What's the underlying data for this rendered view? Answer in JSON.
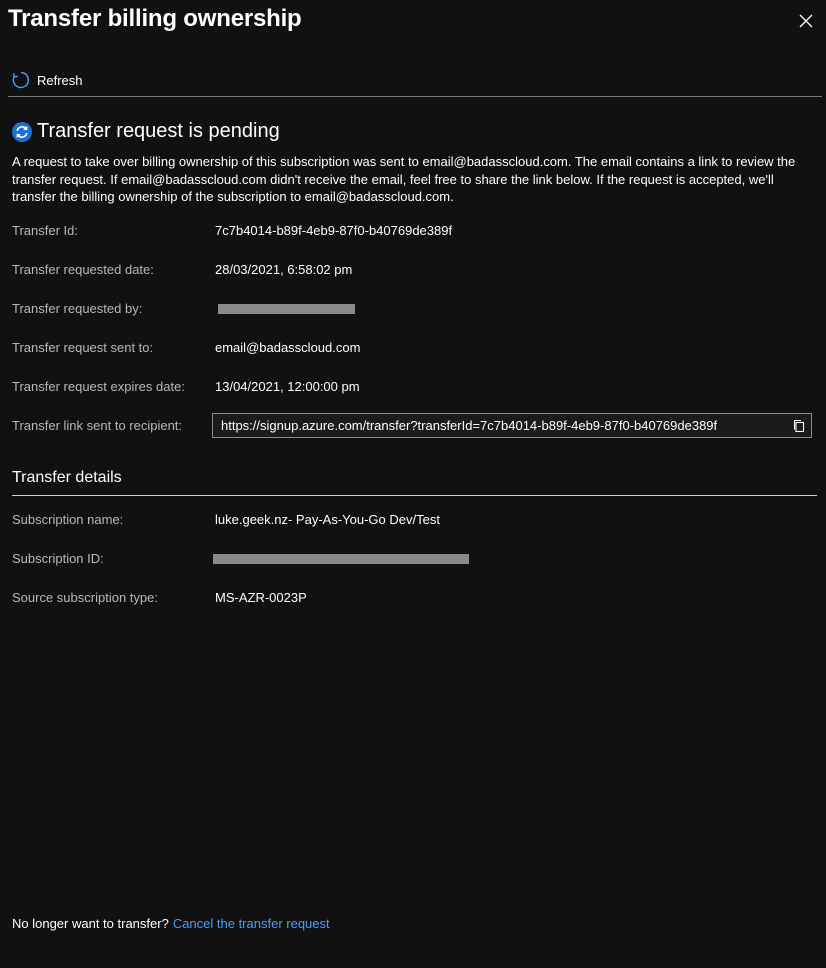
{
  "panel": {
    "title": "Transfer billing ownership",
    "close_icon": "close-icon"
  },
  "toolbar": {
    "refresh_label": "Refresh",
    "refresh_icon": "refresh-icon"
  },
  "status": {
    "heading": "Transfer request is pending",
    "icon": "sync-status-icon",
    "description": "A request to take over billing ownership of this subscription was sent to email@badasscloud.com. The email contains a link to review the transfer request. If email@badasscloud.com didn't receive the email, feel free to share the link below. If the request is accepted, we'll transfer the billing ownership of the subscription to email@badasscloud.com."
  },
  "transfer": {
    "id_label": "Transfer Id:",
    "id_value": "7c7b4014-b89f-4eb9-87f0-b40769de389f",
    "date_label": "Transfer requested date:",
    "date_value": "28/03/2021, 6:58:02 pm",
    "by_label": "Transfer requested by:",
    "sent_to_label": "Transfer request sent to:",
    "sent_to_value": "email@badasscloud.com",
    "expires_label": "Transfer request expires date:",
    "expires_value": "13/04/2021, 12:00:00 pm",
    "link_label": "Transfer link sent to recipient:",
    "link_value": "https://signup.azure.com/transfer?transferId=7c7b4014-b89f-4eb9-87f0-b40769de389f",
    "copy_icon": "copy-icon"
  },
  "details": {
    "heading": "Transfer details",
    "sub_name_label": "Subscription name:",
    "sub_name_value": "luke.geek.nz- Pay-As-You-Go Dev/Test",
    "sub_id_label": "Subscription ID:",
    "source_type_label": "Source subscription type:",
    "source_type_value": "MS-AZR-0023P"
  },
  "footer": {
    "prompt": "No longer want to transfer?",
    "cancel_link": "Cancel the transfer request"
  },
  "colors": {
    "background": "#111112",
    "link": "#4f9cf0",
    "status_icon": "#1f6fd6",
    "muted_label": "#b8b8b8"
  }
}
